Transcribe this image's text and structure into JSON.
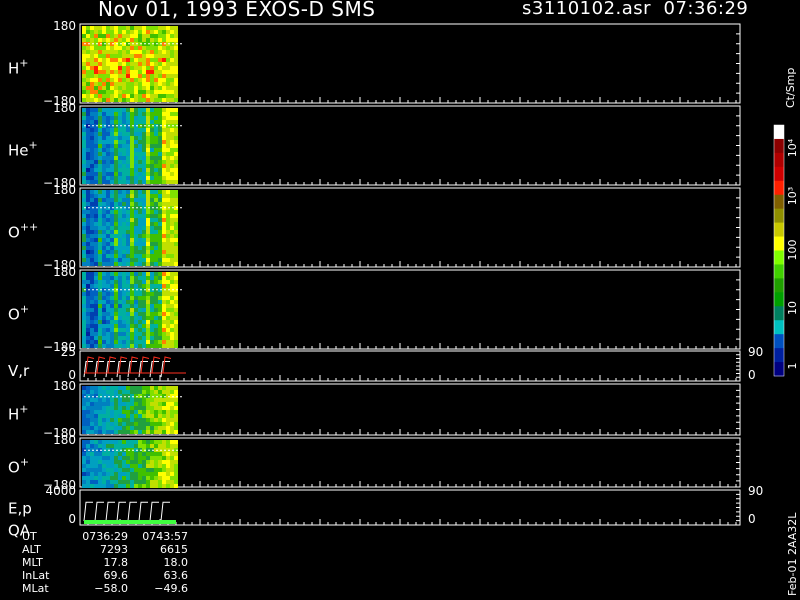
{
  "header": {
    "title": "Nov 01, 1993   EXOS-D SMS",
    "filename": "s3110102.asr",
    "time": "07:36:29"
  },
  "panels": [
    {
      "label": "H",
      "sup": "+",
      "ymax": "180",
      "ymin": "−180"
    },
    {
      "label": "He",
      "sup": "+",
      "ymax": "180",
      "ymin": "−180"
    },
    {
      "label": "O",
      "sup": "++",
      "ymax": "180",
      "ymin": "−180"
    },
    {
      "label": "O",
      "sup": "+",
      "ymax": "180",
      "ymin": "−180"
    },
    {
      "label": "V,r",
      "sup": "",
      "ymax": "25",
      "ymin": "0",
      "rmax": "90",
      "rmin": "0"
    },
    {
      "label": "H",
      "sup": "+",
      "ymax": "180",
      "ymin": "−180"
    },
    {
      "label": "O",
      "sup": "+",
      "ymax": "180",
      "ymin": "−180"
    },
    {
      "label": "E,p",
      "label2": "QA",
      "sup": "",
      "ymax": "4000",
      "ymin": "0",
      "rmax": "90",
      "rmin": "0"
    }
  ],
  "colorbar": {
    "title": "Ct/Smp",
    "ticks": [
      "10⁴",
      "10³",
      "100",
      "10",
      "1"
    ],
    "colors": [
      "#ffffff",
      "#8b0000",
      "#b00000",
      "#d00000",
      "#ff2000",
      "#806000",
      "#909000",
      "#c8c800",
      "#ffff00",
      "#80ff00",
      "#40d000",
      "#20a000",
      "#00a000",
      "#008060",
      "#00c0c0",
      "#0050c0",
      "#0020a0",
      "#000080"
    ]
  },
  "footer_stamp": "Feb-01 2AA32L",
  "info": {
    "rows": [
      {
        "key": "UT",
        "v1": "0736:29",
        "v2": "0743:57"
      },
      {
        "key": "ALT",
        "v1": "7293",
        "v2": "6615"
      },
      {
        "key": "MLT",
        "v1": "17.8",
        "v2": "18.0"
      },
      {
        "key": "InLat",
        "v1": "69.6",
        "v2": "63.6"
      },
      {
        "key": "MLat",
        "v1": "−58.0",
        "v2": "−49.6"
      }
    ]
  },
  "chart_data": {
    "type": "heatmap",
    "title": "Nov 01, 1993   EXOS-D SMS",
    "xlabel": "UT",
    "x_start": "0736:29",
    "x_end": "0743:57",
    "colorbar_label": "Ct/Smp",
    "colorbar_scale": "log",
    "colorbar_range": [
      1,
      10000
    ],
    "series": [
      {
        "name": "H+",
        "ylim": [
          -180,
          180
        ]
      },
      {
        "name": "He+",
        "ylim": [
          -180,
          180
        ]
      },
      {
        "name": "O++",
        "ylim": [
          -180,
          180
        ]
      },
      {
        "name": "O+",
        "ylim": [
          -180,
          180
        ]
      },
      {
        "name": "V,r",
        "ylim": [
          0,
          25
        ],
        "right_ylim": [
          0,
          90
        ]
      },
      {
        "name": "H+",
        "ylim": [
          -180,
          180
        ]
      },
      {
        "name": "O+",
        "ylim": [
          -180,
          180
        ]
      },
      {
        "name": "E,p / QA",
        "ylim": [
          0,
          4000
        ],
        "right_ylim": [
          0,
          90
        ]
      }
    ]
  }
}
